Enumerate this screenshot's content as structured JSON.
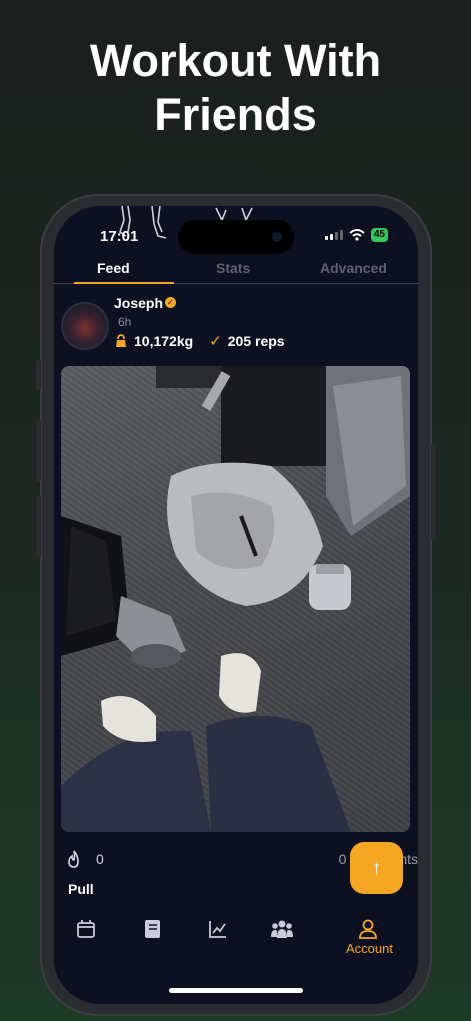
{
  "headline": [
    "Workout With",
    "Friends"
  ],
  "status_bar": {
    "time": "17:01",
    "battery": "45"
  },
  "tabs": [
    {
      "label": "Feed",
      "active": true
    },
    {
      "label": "Stats",
      "active": false
    },
    {
      "label": "Advanced",
      "active": false
    }
  ],
  "post": {
    "user": "Joseph",
    "time_ago": "6h",
    "weight": "10,172kg",
    "reps": "205 reps",
    "likes": "0",
    "comments": "0 Comments",
    "workout_title": "Pull"
  },
  "nav": {
    "items": [
      "calendar-icon",
      "book-icon",
      "chart-icon",
      "friends-icon",
      "account-icon"
    ],
    "active_label": "Account"
  },
  "colors": {
    "accent": "#f5a623",
    "screen_bg": "#0d1020",
    "tab_inactive": "#5d6070"
  }
}
